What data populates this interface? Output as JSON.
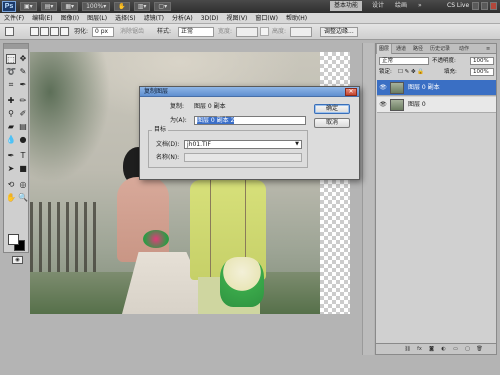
{
  "app": {
    "logo": "Ps",
    "workspace_active": "基本功能",
    "workspace_design": "设计",
    "workspace_paint": "绘画",
    "workspace_more": "»",
    "cs_live": "CS Live"
  },
  "menubar": [
    "文件(F)",
    "编辑(E)",
    "图像(I)",
    "图层(L)",
    "选择(S)",
    "滤镜(T)",
    "分析(A)",
    "3D(D)",
    "视图(V)",
    "窗口(W)",
    "帮助(H)"
  ],
  "options": {
    "feather_label": "羽化:",
    "feather_value": "0 px",
    "antialias_label": "消除锯齿",
    "style_label": "样式:",
    "style_value": "正常",
    "width_label": "宽度:",
    "height_label": "高度:",
    "refine_edge": "调整边缘..."
  },
  "dialog": {
    "title": "复制图层",
    "copy_label": "复制:",
    "copy_value": "图层 0 副本",
    "as_label": "为(A):",
    "as_value": "图层 0 副本 2",
    "ok": "确定",
    "cancel": "取消",
    "target_label": "目标",
    "doc_label": "文档(D):",
    "doc_value": "jh01.TIF",
    "name_label": "名称(N):"
  },
  "layers_panel": {
    "tabs": [
      "图层",
      "通道",
      "路径",
      "历史记录",
      "动作"
    ],
    "blend_mode": "正常",
    "opacity_label": "不透明度:",
    "opacity_value": "100%",
    "lock_label": "锁定:",
    "fill_label": "填充:",
    "fill_value": "100%",
    "layers": [
      {
        "name": "图层 0 副本",
        "active": true
      },
      {
        "name": "图层 0",
        "active": false
      }
    ]
  },
  "colors": {
    "app_bar": "#3a3a3a",
    "selection_blue": "#3b6fc9",
    "dialog_bg": "#dcdcdc"
  }
}
